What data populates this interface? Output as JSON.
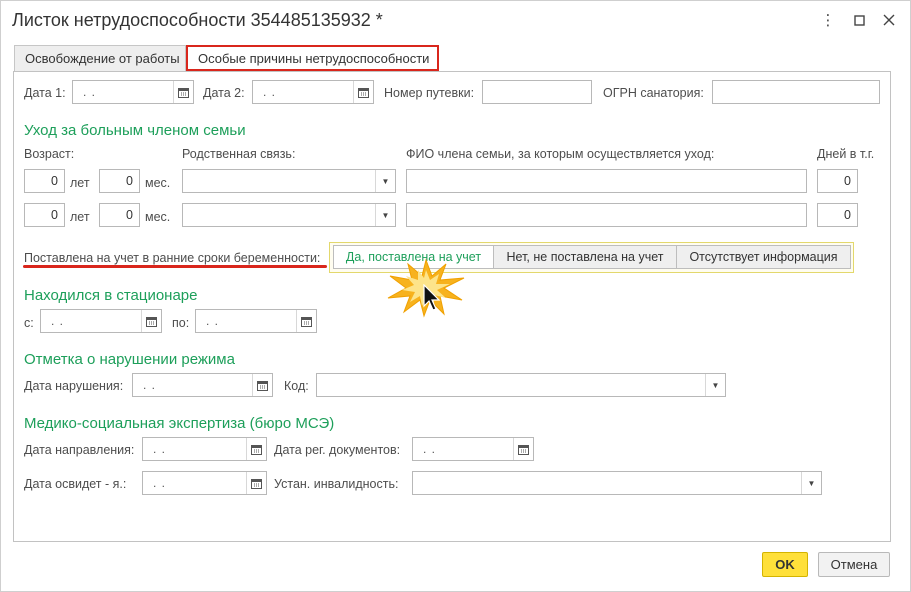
{
  "window": {
    "title": "Листок нетрудоспособности 354485135932 *",
    "more_glyph": "⋮",
    "maximize_glyph": "☐",
    "close_glyph": "✕"
  },
  "tabs": [
    {
      "label": "Освобождение от работы"
    },
    {
      "label": "Особые причины нетрудоспособности"
    }
  ],
  "top_row": {
    "date1_label": "Дата 1:",
    "date1_value": " .  .",
    "date2_label": "Дата 2:",
    "date2_value": " .  .",
    "voucher_label": "Номер путевки:",
    "voucher_value": "",
    "ogrn_label": "ОГРН санатория:",
    "ogrn_value": ""
  },
  "care": {
    "section_title": "Уход за больным членом семьи",
    "age_label": "Возраст:",
    "relation_label": "Родственная связь:",
    "fio_label": "ФИО члена семьи, за которым осуществляется уход:",
    "days_label": "Дней в т.г.",
    "years_unit": "лет",
    "months_unit": "мес.",
    "rows": [
      {
        "years": "0",
        "months": "0",
        "relation": "",
        "fio": "",
        "days": "0"
      },
      {
        "years": "0",
        "months": "0",
        "relation": "",
        "fio": "",
        "days": "0"
      }
    ]
  },
  "pregnancy": {
    "label": "Поставлена на учет в ранние сроки беременности:",
    "options": [
      {
        "label": "Да, поставлена на учет",
        "selected": true
      },
      {
        "label": "Нет, не поставлена на учет",
        "selected": false
      },
      {
        "label": "Отсутствует информация",
        "selected": false
      }
    ]
  },
  "hospital": {
    "section_title": "Находился в стационаре",
    "from_label": "с:",
    "from_value": " .  .",
    "to_label": "по:",
    "to_value": " .  ."
  },
  "violation": {
    "section_title": "Отметка о нарушении режима",
    "date_label": "Дата нарушения:",
    "date_value": " .  .",
    "code_label": "Код:",
    "code_value": ""
  },
  "mse": {
    "section_title": "Медико-социальная экспертиза (бюро МСЭ)",
    "referral_label": "Дата направления:",
    "referral_value": " .  .",
    "reg_label": "Дата рег. документов:",
    "reg_value": " .  .",
    "exam_label": "Дата освидет - я.:",
    "exam_value": " .  .",
    "disability_label": "Устан. инвалидность:",
    "disability_value": ""
  },
  "footer": {
    "ok_label": "OK",
    "cancel_label": "Отмена"
  },
  "colors": {
    "accent_green": "#1d9f5a",
    "highlight_red": "#d9261c",
    "ok_yellow": "#ffe03a"
  }
}
